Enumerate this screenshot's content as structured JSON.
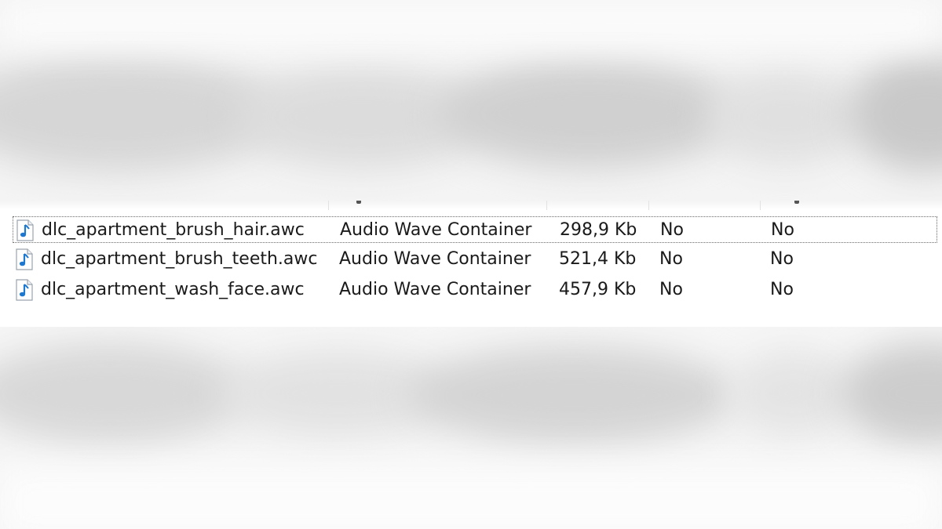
{
  "files": [
    {
      "name": "dlc_apartment_brush_hair.awc",
      "type": "Audio Wave Container",
      "size": "298,9 Kb",
      "flag1": "No",
      "flag2": "No",
      "icon": "audio-file-icon"
    },
    {
      "name": "dlc_apartment_brush_teeth.awc",
      "type": "Audio Wave Container",
      "size": "521,4 Kb",
      "flag1": "No",
      "flag2": "No",
      "icon": "audio-file-icon"
    },
    {
      "name": "dlc_apartment_wash_face.awc",
      "type": "Audio Wave Container",
      "size": "457,9 Kb",
      "flag1": "No",
      "flag2": "No",
      "icon": "audio-file-icon"
    }
  ],
  "colors": {
    "icon_note": "#1e78d0",
    "focus_border": "#6a6a6a"
  }
}
